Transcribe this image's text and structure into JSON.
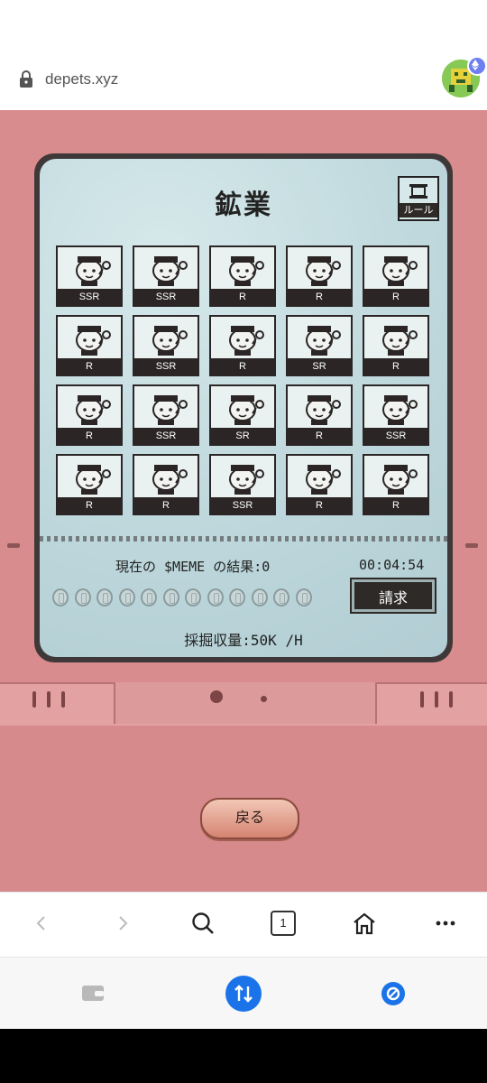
{
  "browser": {
    "domain": "depets.xyz",
    "tab_count": "1"
  },
  "game": {
    "title": "鉱業",
    "rule_label": "ルール",
    "cards": [
      [
        "SSR",
        "SSR",
        "R",
        "R",
        "R"
      ],
      [
        "R",
        "SSR",
        "R",
        "SR",
        "R"
      ],
      [
        "R",
        "SSR",
        "SR",
        "R",
        "SSR"
      ],
      [
        "R",
        "R",
        "SSR",
        "R",
        "R"
      ]
    ],
    "status": "現在の $MEME の結果:0",
    "timer": "00:04:54",
    "claim_label": "請求",
    "rate": "採掘収量:50K /H",
    "back_label": "戻る",
    "coin_count": 12
  },
  "colors": {
    "console": "#d88c8d",
    "screen": "#c6dde1",
    "dark": "#2b2625",
    "accent_blue": "#1a73e8"
  }
}
